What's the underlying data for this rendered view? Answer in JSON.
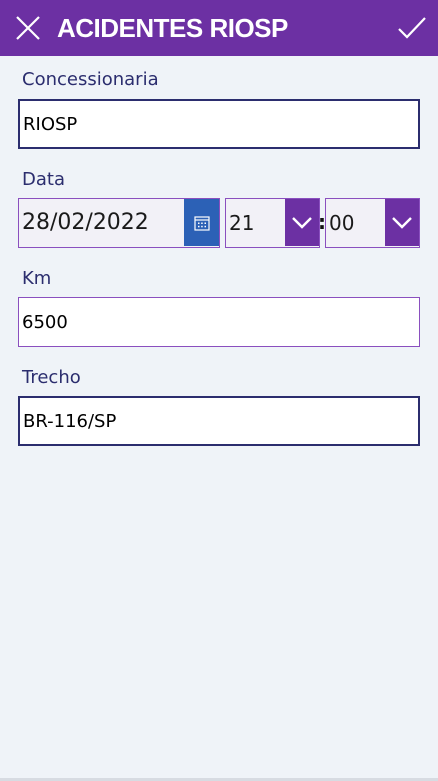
{
  "header": {
    "title": "ACIDENTES RIOSP",
    "close_icon": "close-icon",
    "confirm_icon": "checkmark-icon",
    "background_color": "#6c30a3"
  },
  "form": {
    "concessionaria": {
      "label": "Concessionaria",
      "value": "RIOSP"
    },
    "data": {
      "label": "Data",
      "date_value": "28/02/2022",
      "calendar_icon": "calendar-icon",
      "hour_value": "21",
      "minute_value": "00",
      "separator": ":"
    },
    "km": {
      "label": "Km",
      "value": "6500"
    },
    "trecho": {
      "label": "Trecho",
      "value": "BR-116/SP"
    }
  }
}
